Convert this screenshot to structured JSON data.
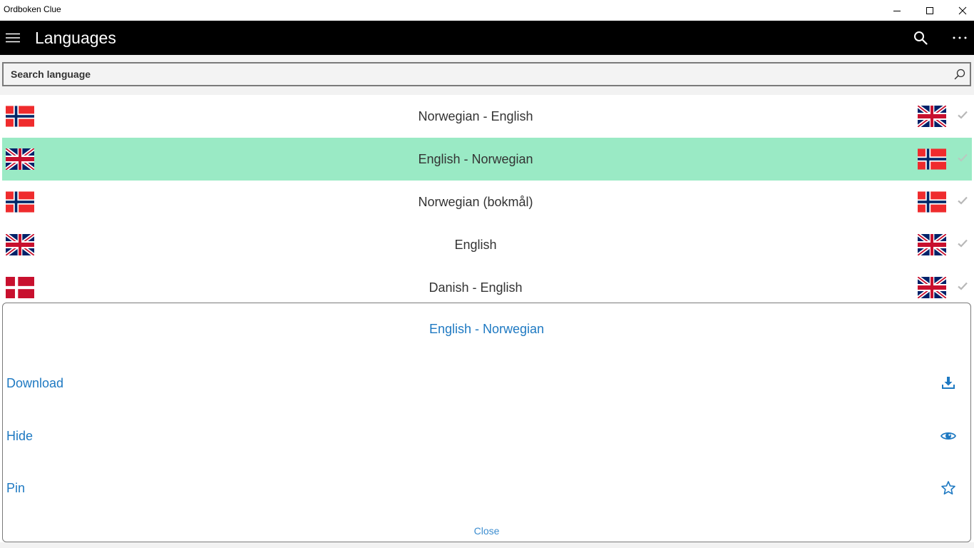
{
  "window": {
    "title": "Ordboken Clue",
    "controls": [
      "minimize-icon",
      "maximize-icon",
      "close-icon"
    ]
  },
  "appbar": {
    "title": "Languages",
    "icons": [
      "hamburger-menu-icon",
      "search-icon",
      "more-options-icon"
    ]
  },
  "search": {
    "placeholder": "Search language",
    "value": ""
  },
  "languages": [
    {
      "label": "Norwegian - English",
      "left_flag": "norway-flag-icon",
      "right_flag": "uk-flag-icon",
      "selected": false
    },
    {
      "label": "English - Norwegian",
      "left_flag": "uk-flag-icon",
      "right_flag": "norway-flag-icon",
      "selected": true
    },
    {
      "label": "Norwegian (bokmål)",
      "left_flag": "norway-flag-icon",
      "right_flag": "norway-flag-icon",
      "selected": false
    },
    {
      "label": "English",
      "left_flag": "uk-flag-icon",
      "right_flag": "uk-flag-icon",
      "selected": false
    },
    {
      "label": "Danish - English",
      "left_flag": "denmark-flag-icon",
      "right_flag": "uk-flag-icon",
      "selected": false
    }
  ],
  "flyout": {
    "title": "English - Norwegian",
    "actions": [
      {
        "label": "Download",
        "icon": "download-icon"
      },
      {
        "label": "Hide",
        "icon": "eye-icon"
      },
      {
        "label": "Pin",
        "icon": "star-icon"
      }
    ],
    "close_label": "Close"
  },
  "colors": {
    "accent": "#1e79c2",
    "selected_row": "#9aeac5",
    "appbar_bg": "#000000",
    "norway_red": "#ef2b2d",
    "norway_blue": "#002868",
    "uk_blue": "#012169",
    "uk_red": "#c8102e",
    "denmark_red": "#c8102e"
  }
}
